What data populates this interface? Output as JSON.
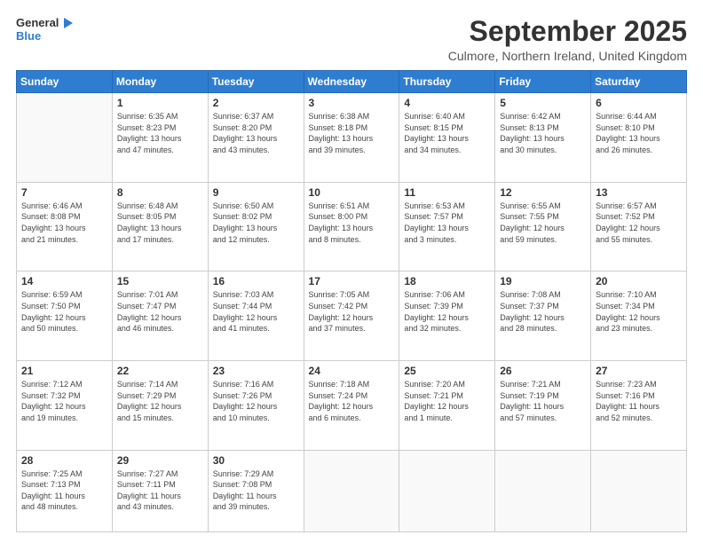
{
  "header": {
    "logo_line1": "General",
    "logo_line2": "Blue",
    "month": "September 2025",
    "location": "Culmore, Northern Ireland, United Kingdom"
  },
  "weekdays": [
    "Sunday",
    "Monday",
    "Tuesday",
    "Wednesday",
    "Thursday",
    "Friday",
    "Saturday"
  ],
  "weeks": [
    [
      {
        "day": "",
        "info": ""
      },
      {
        "day": "1",
        "info": "Sunrise: 6:35 AM\nSunset: 8:23 PM\nDaylight: 13 hours\nand 47 minutes."
      },
      {
        "day": "2",
        "info": "Sunrise: 6:37 AM\nSunset: 8:20 PM\nDaylight: 13 hours\nand 43 minutes."
      },
      {
        "day": "3",
        "info": "Sunrise: 6:38 AM\nSunset: 8:18 PM\nDaylight: 13 hours\nand 39 minutes."
      },
      {
        "day": "4",
        "info": "Sunrise: 6:40 AM\nSunset: 8:15 PM\nDaylight: 13 hours\nand 34 minutes."
      },
      {
        "day": "5",
        "info": "Sunrise: 6:42 AM\nSunset: 8:13 PM\nDaylight: 13 hours\nand 30 minutes."
      },
      {
        "day": "6",
        "info": "Sunrise: 6:44 AM\nSunset: 8:10 PM\nDaylight: 13 hours\nand 26 minutes."
      }
    ],
    [
      {
        "day": "7",
        "info": "Sunrise: 6:46 AM\nSunset: 8:08 PM\nDaylight: 13 hours\nand 21 minutes."
      },
      {
        "day": "8",
        "info": "Sunrise: 6:48 AM\nSunset: 8:05 PM\nDaylight: 13 hours\nand 17 minutes."
      },
      {
        "day": "9",
        "info": "Sunrise: 6:50 AM\nSunset: 8:02 PM\nDaylight: 13 hours\nand 12 minutes."
      },
      {
        "day": "10",
        "info": "Sunrise: 6:51 AM\nSunset: 8:00 PM\nDaylight: 13 hours\nand 8 minutes."
      },
      {
        "day": "11",
        "info": "Sunrise: 6:53 AM\nSunset: 7:57 PM\nDaylight: 13 hours\nand 3 minutes."
      },
      {
        "day": "12",
        "info": "Sunrise: 6:55 AM\nSunset: 7:55 PM\nDaylight: 12 hours\nand 59 minutes."
      },
      {
        "day": "13",
        "info": "Sunrise: 6:57 AM\nSunset: 7:52 PM\nDaylight: 12 hours\nand 55 minutes."
      }
    ],
    [
      {
        "day": "14",
        "info": "Sunrise: 6:59 AM\nSunset: 7:50 PM\nDaylight: 12 hours\nand 50 minutes."
      },
      {
        "day": "15",
        "info": "Sunrise: 7:01 AM\nSunset: 7:47 PM\nDaylight: 12 hours\nand 46 minutes."
      },
      {
        "day": "16",
        "info": "Sunrise: 7:03 AM\nSunset: 7:44 PM\nDaylight: 12 hours\nand 41 minutes."
      },
      {
        "day": "17",
        "info": "Sunrise: 7:05 AM\nSunset: 7:42 PM\nDaylight: 12 hours\nand 37 minutes."
      },
      {
        "day": "18",
        "info": "Sunrise: 7:06 AM\nSunset: 7:39 PM\nDaylight: 12 hours\nand 32 minutes."
      },
      {
        "day": "19",
        "info": "Sunrise: 7:08 AM\nSunset: 7:37 PM\nDaylight: 12 hours\nand 28 minutes."
      },
      {
        "day": "20",
        "info": "Sunrise: 7:10 AM\nSunset: 7:34 PM\nDaylight: 12 hours\nand 23 minutes."
      }
    ],
    [
      {
        "day": "21",
        "info": "Sunrise: 7:12 AM\nSunset: 7:32 PM\nDaylight: 12 hours\nand 19 minutes."
      },
      {
        "day": "22",
        "info": "Sunrise: 7:14 AM\nSunset: 7:29 PM\nDaylight: 12 hours\nand 15 minutes."
      },
      {
        "day": "23",
        "info": "Sunrise: 7:16 AM\nSunset: 7:26 PM\nDaylight: 12 hours\nand 10 minutes."
      },
      {
        "day": "24",
        "info": "Sunrise: 7:18 AM\nSunset: 7:24 PM\nDaylight: 12 hours\nand 6 minutes."
      },
      {
        "day": "25",
        "info": "Sunrise: 7:20 AM\nSunset: 7:21 PM\nDaylight: 12 hours\nand 1 minute."
      },
      {
        "day": "26",
        "info": "Sunrise: 7:21 AM\nSunset: 7:19 PM\nDaylight: 11 hours\nand 57 minutes."
      },
      {
        "day": "27",
        "info": "Sunrise: 7:23 AM\nSunset: 7:16 PM\nDaylight: 11 hours\nand 52 minutes."
      }
    ],
    [
      {
        "day": "28",
        "info": "Sunrise: 7:25 AM\nSunset: 7:13 PM\nDaylight: 11 hours\nand 48 minutes."
      },
      {
        "day": "29",
        "info": "Sunrise: 7:27 AM\nSunset: 7:11 PM\nDaylight: 11 hours\nand 43 minutes."
      },
      {
        "day": "30",
        "info": "Sunrise: 7:29 AM\nSunset: 7:08 PM\nDaylight: 11 hours\nand 39 minutes."
      },
      {
        "day": "",
        "info": ""
      },
      {
        "day": "",
        "info": ""
      },
      {
        "day": "",
        "info": ""
      },
      {
        "day": "",
        "info": ""
      }
    ]
  ]
}
